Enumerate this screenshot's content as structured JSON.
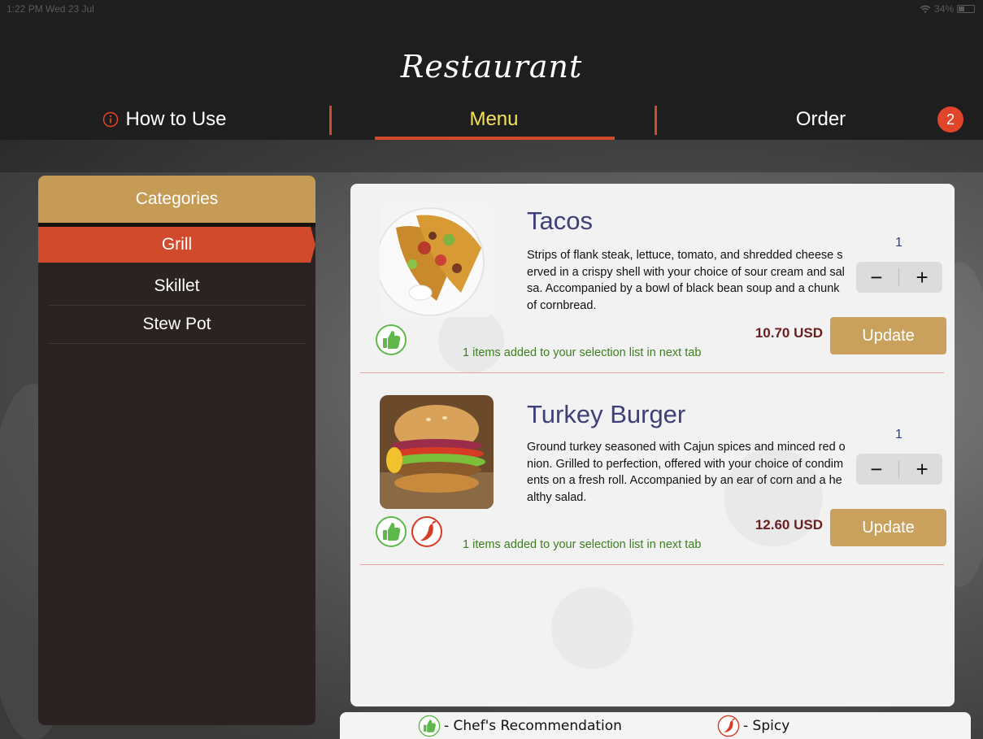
{
  "status_bar": {
    "time": "1:22 PM  Wed 23 Jul",
    "battery": "34%"
  },
  "header": {
    "brand": "Restaurant",
    "tabs": [
      {
        "label": "How to Use"
      },
      {
        "label": "Menu"
      },
      {
        "label": "Order"
      }
    ],
    "order_count": "2"
  },
  "categories": {
    "title": "Categories",
    "items": [
      {
        "label": "Grill",
        "active": true
      },
      {
        "label": "Skillet"
      },
      {
        "label": "Stew Pot"
      }
    ]
  },
  "menu_items": [
    {
      "name": "Tacos",
      "description": "Strips of flank steak, lettuce, tomato, and shredded cheese served in a crispy shell with your choice of sour cream and salsa. Accompanied by a bowl of black bean soup and a chunk of cornbread.",
      "quantity": "1",
      "minus": "−",
      "plus": "+",
      "price": "10.70 USD",
      "update_label": "Update",
      "added_note": "1 items added to your selection list in next tab",
      "badges": [
        "thumb-icon"
      ]
    },
    {
      "name": "Turkey Burger",
      "description": "Ground turkey seasoned with Cajun spices and minced red onion. Grilled to perfection, offered with your choice of condiments on a fresh roll. Accompanied by an ear of corn and a healthy salad.",
      "quantity": "1",
      "minus": "−",
      "plus": "+",
      "price": "12.60 USD",
      "update_label": "Update",
      "added_note": "1 items added to your selection list in next tab",
      "badges": [
        "thumb-icon",
        "chili-icon"
      ]
    }
  ],
  "legend": {
    "chef": "- Chef's Recommendation",
    "spicy": "- Spicy"
  },
  "colors": {
    "accent_red": "#d24a2c",
    "gold": "#c59b55",
    "active_tab_text": "#f3e257",
    "recommend_green": "#5fb84a"
  }
}
